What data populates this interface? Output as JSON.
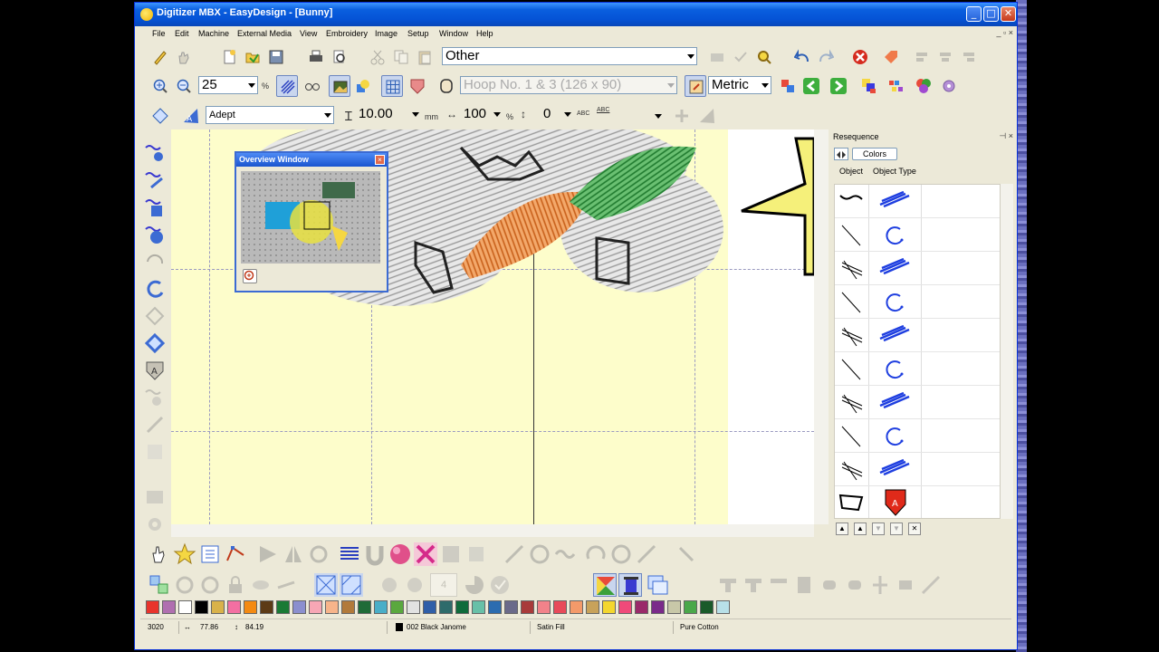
{
  "window": {
    "title": "Digitizer MBX - EasyDesign - [Bunny]",
    "controls": [
      "_",
      "□",
      "✕"
    ],
    "mdi_controls": "_ ▫ ×"
  },
  "menu": [
    "File",
    "Edit",
    "Machine",
    "External Media",
    "View",
    "Embroidery",
    "Image",
    "Setup",
    "Window",
    "Help"
  ],
  "toolbar1": {
    "category_value": "Other"
  },
  "toolbar2": {
    "zoom_value": "25",
    "zoom_unit": "%",
    "hoop_value": "Hoop No. 1 & 3 (126 x 90)",
    "units_value": "Metric"
  },
  "toolbar3": {
    "font_value": "Adept",
    "height_value": "10.00",
    "height_unit": "mm",
    "width_value": "100",
    "width_unit": "%",
    "spacing_value": "0",
    "abc_label_1": "ABC",
    "abc_label_2": "ABC"
  },
  "overview": {
    "title": "Overview Window",
    "close": "×"
  },
  "resequence": {
    "title": "Resequence",
    "pin": "⊣ ×",
    "colors_button": "Colors",
    "col_object": "Object",
    "col_type": "Object Type",
    "rows": [
      {
        "object": "squiggle",
        "type": "fill"
      },
      {
        "object": "line",
        "type": "circle"
      },
      {
        "object": "double-line",
        "type": "fill"
      },
      {
        "object": "line",
        "type": "circle"
      },
      {
        "object": "double-line",
        "type": "fill"
      },
      {
        "object": "line",
        "type": "circle"
      },
      {
        "object": "double-line",
        "type": "fill"
      },
      {
        "object": "line",
        "type": "circle"
      },
      {
        "object": "double-line",
        "type": "fill"
      },
      {
        "object": "polygon",
        "type": "shield"
      }
    ],
    "bottom_buttons": [
      "▲",
      "▲",
      "▼",
      "▼",
      "✕"
    ]
  },
  "palette": [
    "#e8342c",
    "#b06fb0",
    "#ffffff",
    "#000000",
    "#d9b24a",
    "#f36fa2",
    "#f48a12",
    "#5c3a16",
    "#1a7a35",
    "#8b8fcf",
    "#f7a7b5",
    "#f7b48a",
    "#b27a3a",
    "#1f6b38",
    "#4aaec8",
    "#5aa83e",
    "#e2e2e2",
    "#2f5ea8",
    "#2e6b6b",
    "#0f6b3c",
    "#68c0a8",
    "#2b6cb0",
    "#6a6a8a",
    "#a83a3a",
    "#f2828a",
    "#e84a5a",
    "#f49a6a",
    "#c8a25a",
    "#f4d72e",
    "#f04a7a",
    "#9a2a6a",
    "#7a2a8a",
    "#c8c8a8",
    "#4aa84a",
    "#1a5a2a",
    "#b8e0e8"
  ],
  "status": {
    "stitches": "3020",
    "width": "77.86",
    "height": "84.19",
    "color": "002 Black Janome",
    "stitch_type": "Satin Fill",
    "fabric": "Pure Cotton"
  },
  "colors": {
    "titlebar": "#0553d6",
    "canvas_yellow": "#fdfdcb",
    "carrot_orange": "#e8822e",
    "leaf_green": "#3a9a44"
  }
}
